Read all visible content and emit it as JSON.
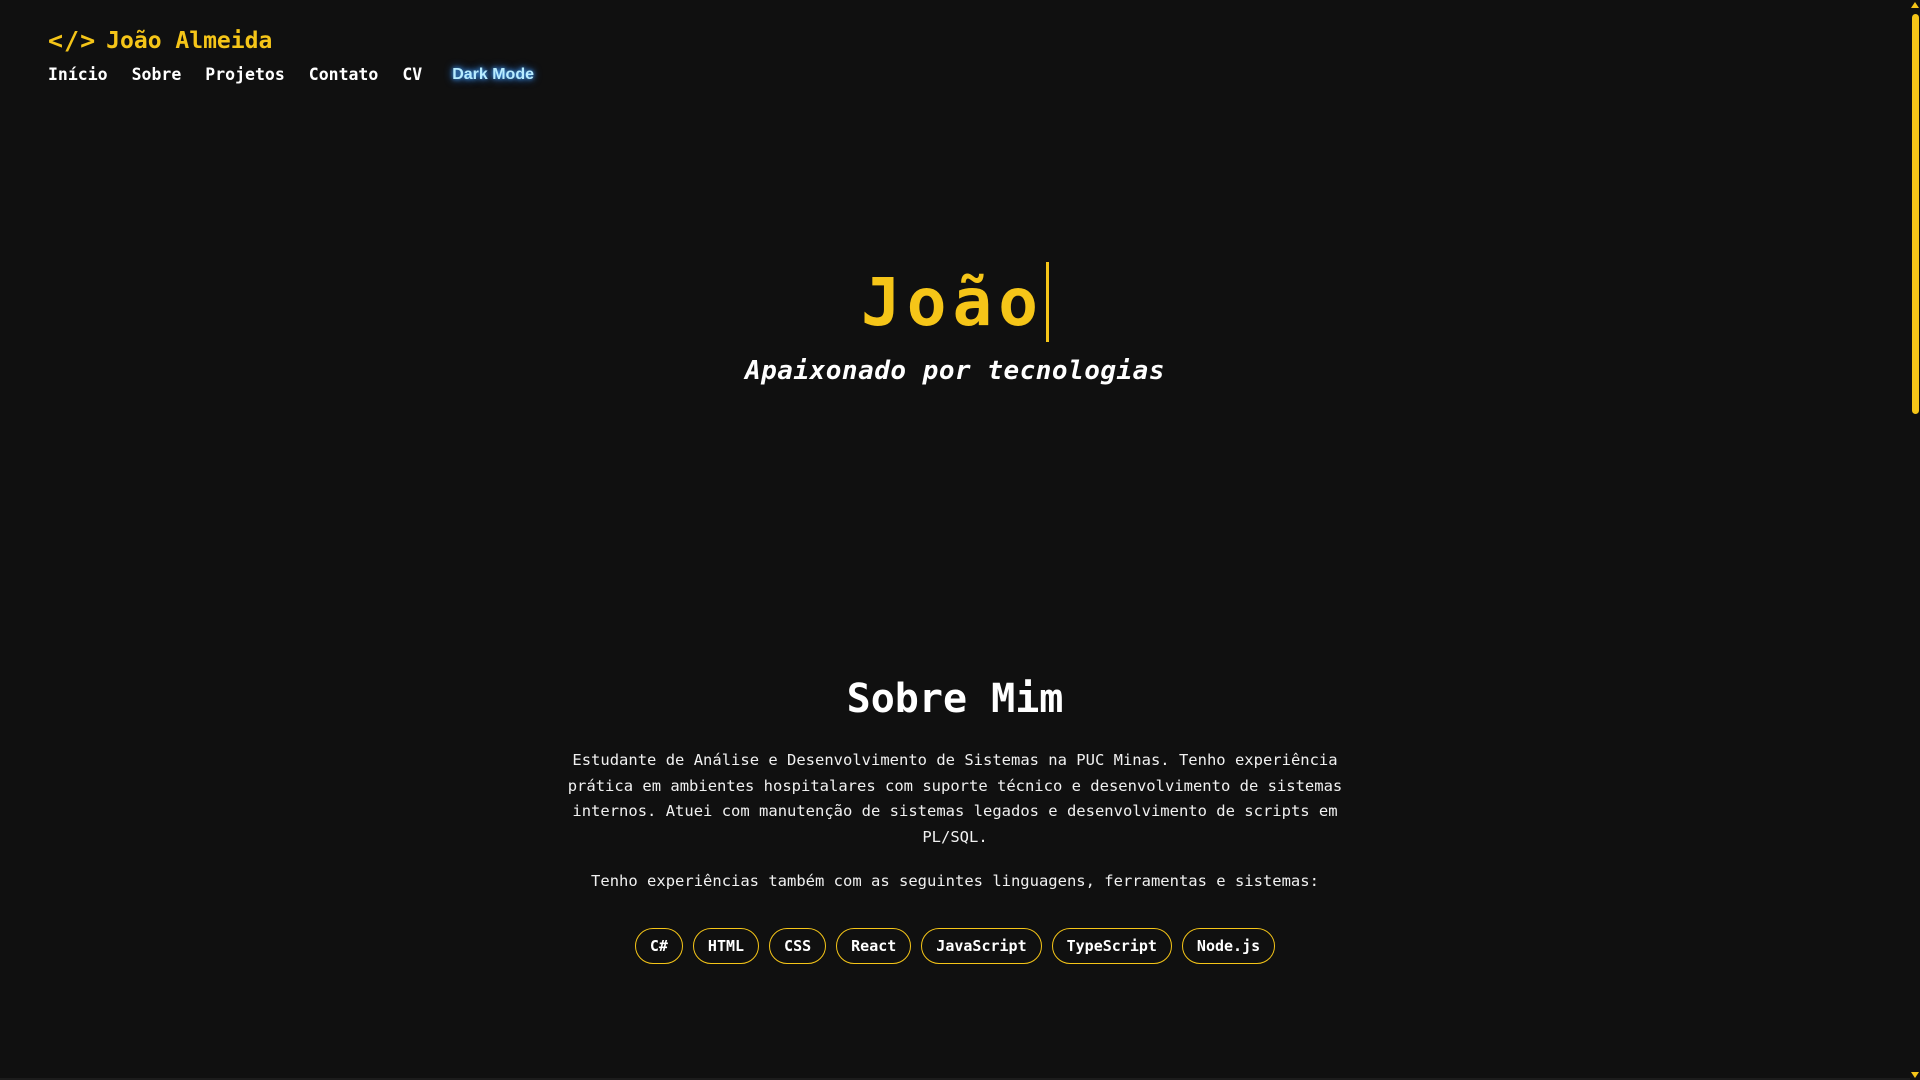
{
  "colors": {
    "background": "#101010",
    "accent": "#f5c518",
    "text": "#ffffff",
    "dark_mode_glow": "#b8ecff"
  },
  "header": {
    "logo_icon": "code-icon",
    "logo_code": "</>",
    "logo_name": "João Almeida",
    "nav": [
      {
        "label": "Início"
      },
      {
        "label": "Sobre"
      },
      {
        "label": "Projetos"
      },
      {
        "label": "Contato"
      },
      {
        "label": "CV"
      }
    ],
    "dark_mode_label": "Dark Mode"
  },
  "hero": {
    "title": "João",
    "subtitle": "Apaixonado por tecnologias"
  },
  "about": {
    "title": "Sobre Mim",
    "paragraph1": "Estudante de Análise e Desenvolvimento de Sistemas na PUC Minas. Tenho experiência prática em ambientes hospitalares com suporte técnico e desenvolvimento de sistemas internos. Atuei com manutenção de sistemas legados e desenvolvimento de scripts em PL/SQL.",
    "paragraph2": "Tenho experiências também com as seguintes linguagens, ferramentas e sistemas:",
    "skills": [
      "C#",
      "HTML",
      "CSS",
      "React",
      "JavaScript",
      "TypeScript",
      "Node.js"
    ]
  }
}
